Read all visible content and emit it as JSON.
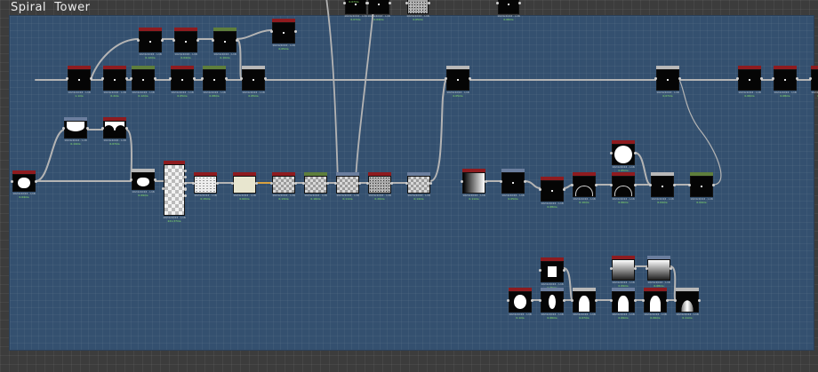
{
  "graph": {
    "title": "Spiral  Tower",
    "colors": {
      "red": "#8e1b1f",
      "green": "#5e7e3c",
      "gray": "#b8b8b8",
      "slate": "#6b7e9e",
      "canvas": "#34506f",
      "wire": "#b4b4b4",
      "orange_wire": "#d9a13f"
    },
    "nodes": [
      {
        "id": "n1",
        "icon": "circle-mask-icon",
        "cap": "1024x1024 - L16",
        "st": "0.04ms"
      },
      {
        "id": "n2",
        "icon": "cloud-shape-icon",
        "cap": "1024x1024 - L16",
        "st": "0.14ms"
      },
      {
        "id": "n3",
        "icon": "cloud-shape-icon",
        "cap": "1024x1024 - L16",
        "st": "0.07ms"
      },
      {
        "id": "n4",
        "icon": "blob-shape-icon",
        "cap": "1024x1024 - L16",
        "st": "0.09ms"
      },
      {
        "id": "n5",
        "icon": "noise-texture-icon",
        "cap": "1024x1024 - L16",
        "st": "221.37ms"
      },
      {
        "id": "n6",
        "icon": "speckle-texture-icon",
        "cap": "1024x1024 - L16",
        "st": "0.15ms"
      },
      {
        "id": "n7",
        "icon": "flat-color-icon",
        "cap": "1024x1024 - L16",
        "st": "0.62ms"
      },
      {
        "id": "n8",
        "icon": "checker-texture-icon",
        "cap": "1024x1024 - L16",
        "st": "0.13ms"
      },
      {
        "id": "n9",
        "icon": "checker-texture-icon",
        "cap": "1024x1024 - L16",
        "st": "0.16ms"
      },
      {
        "id": "n10",
        "icon": "checker-texture-icon",
        "cap": "1024x1024 - L16",
        "st": "0.11ms"
      },
      {
        "id": "n11",
        "icon": "noise-texture-icon",
        "cap": "1024x1024 - L16",
        "st": "0.20ms"
      },
      {
        "id": "n12",
        "icon": "checker-texture-icon",
        "cap": "1024x1024 - L16",
        "st": "0.14ms"
      },
      {
        "id": "n13",
        "icon": "gradient-icon",
        "cap": "1024x1024 - L16",
        "st": "0.11ms"
      },
      {
        "id": "n14",
        "icon": "blank-preview-icon",
        "cap": "1024x1024 - L16",
        "st": "0.05ms"
      },
      {
        "id": "n15",
        "icon": "blank-preview-icon",
        "cap": "1024x1024 - L16",
        "st": "0.08ms"
      },
      {
        "id": "n16",
        "icon": "dome-shape-icon",
        "cap": "1024x1024 - L16",
        "st": "0.10ms"
      },
      {
        "id": "n17",
        "icon": "dome-shape-icon",
        "cap": "1024x1024 - L16",
        "st": "0.06ms"
      },
      {
        "id": "n18",
        "icon": "blank-preview-icon",
        "cap": "1024x1024 - L16",
        "st": "0.04ms"
      },
      {
        "id": "n19",
        "icon": "blank-preview-icon",
        "cap": "1024x1024 - L16",
        "st": "0.04ms"
      },
      {
        "id": "n20",
        "icon": "big-circle-icon",
        "cap": "1024x1024 - L16",
        "st": "0.05ms"
      },
      {
        "id": "n21",
        "icon": "blank-preview-icon",
        "cap": "1024x1024 - L16",
        "st": "1.1ms"
      },
      {
        "id": "n22",
        "icon": "blank-preview-icon",
        "cap": "1024x1024 - L16",
        "st": "0.2ms"
      },
      {
        "id": "n23",
        "icon": "blank-preview-icon",
        "cap": "1024x1024 - L16",
        "st": "0.12ms"
      },
      {
        "id": "n24",
        "icon": "blank-preview-icon",
        "cap": "1024x1024 - L16",
        "st": "0.05ms"
      },
      {
        "id": "n25",
        "icon": "blank-preview-icon",
        "cap": "1024x1024 - L16",
        "st": "0.08ms"
      },
      {
        "id": "n26",
        "icon": "blank-preview-icon",
        "cap": "1024x1024 - L16",
        "st": "0.05ms"
      },
      {
        "id": "n27",
        "icon": "blank-preview-icon",
        "cap": "1024x1024 - L16",
        "st": "0.12ms"
      },
      {
        "id": "n28",
        "icon": "blank-preview-icon",
        "cap": "1024x1024 - L16",
        "st": "0.04ms"
      },
      {
        "id": "n29",
        "icon": "blank-preview-icon",
        "cap": "1024x1024 - L16",
        "st": "0.10ms"
      },
      {
        "id": "n30",
        "icon": "blank-preview-icon",
        "cap": "1024x1024 - L16",
        "st": "0.05ms"
      },
      {
        "id": "n31",
        "icon": "blank-preview-icon",
        "cap": "1024x1024 - L16",
        "st": "0.05ms"
      },
      {
        "id": "n32",
        "icon": "blank-preview-icon",
        "cap": "1024x1024 - L16",
        "st": "0.07ms"
      },
      {
        "id": "n33",
        "icon": "blank-preview-icon",
        "cap": "1024x1024 - L16",
        "st": "0.06ms"
      },
      {
        "id": "n34",
        "icon": "blank-preview-icon",
        "cap": "1024x1024 - L16",
        "st": "0.08ms"
      },
      {
        "id": "n35",
        "icon": "blank-preview-icon",
        "cap": "1024x1024 - L16",
        "st": "0.05ms"
      },
      {
        "id": "n36",
        "icon": "blank-preview-icon",
        "cap": "1024x1024 - L16",
        "st": "0.07ms"
      },
      {
        "id": "n37",
        "icon": "blank-preview-icon",
        "cap": "1024x1024 - L16",
        "st": "0.04ms"
      },
      {
        "id": "n38",
        "icon": "noise-texture-icon",
        "cap": "1024x1024 - L16",
        "st": "0.05ms"
      },
      {
        "id": "n39",
        "icon": "blank-preview-icon",
        "cap": "1024x1024 - L16",
        "st": "0.06ms"
      },
      {
        "id": "n40",
        "icon": "checker-texture-icon",
        "cap": "1024x1024 - L16",
        "st": "0.07ms"
      },
      {
        "id": "n41",
        "icon": "square-mask-icon",
        "cap": "1024x1024 - L16",
        "st": "0.05ms"
      },
      {
        "id": "n42",
        "icon": "vertical-gradient-icon",
        "cap": "1024x1024 - L16",
        "st": "0.09ms"
      },
      {
        "id": "n43",
        "icon": "vertical-gradient-icon",
        "cap": "1024x1024 - L16",
        "st": "0.08ms"
      },
      {
        "id": "n44",
        "icon": "circle-mask-icon",
        "cap": "1024x1024 - L16",
        "st": "0.1ms"
      },
      {
        "id": "n45",
        "icon": "ellipse-mask-icon",
        "cap": "1024x1024 - L16",
        "st": "0.06ms"
      },
      {
        "id": "n46",
        "icon": "arch-shape-icon",
        "cap": "1024x1024 - L16",
        "st": "0.07ms"
      },
      {
        "id": "n47",
        "icon": "arch-shape-icon",
        "cap": "1024x1024 - L16",
        "st": "0.09ms"
      },
      {
        "id": "n48",
        "icon": "arch-shape-icon",
        "cap": "1024x1024 - L16",
        "st": "0.06ms"
      },
      {
        "id": "n49",
        "icon": "arch-gradient-icon",
        "cap": "1024x1024 - L16",
        "st": "0.11ms"
      }
    ]
  }
}
